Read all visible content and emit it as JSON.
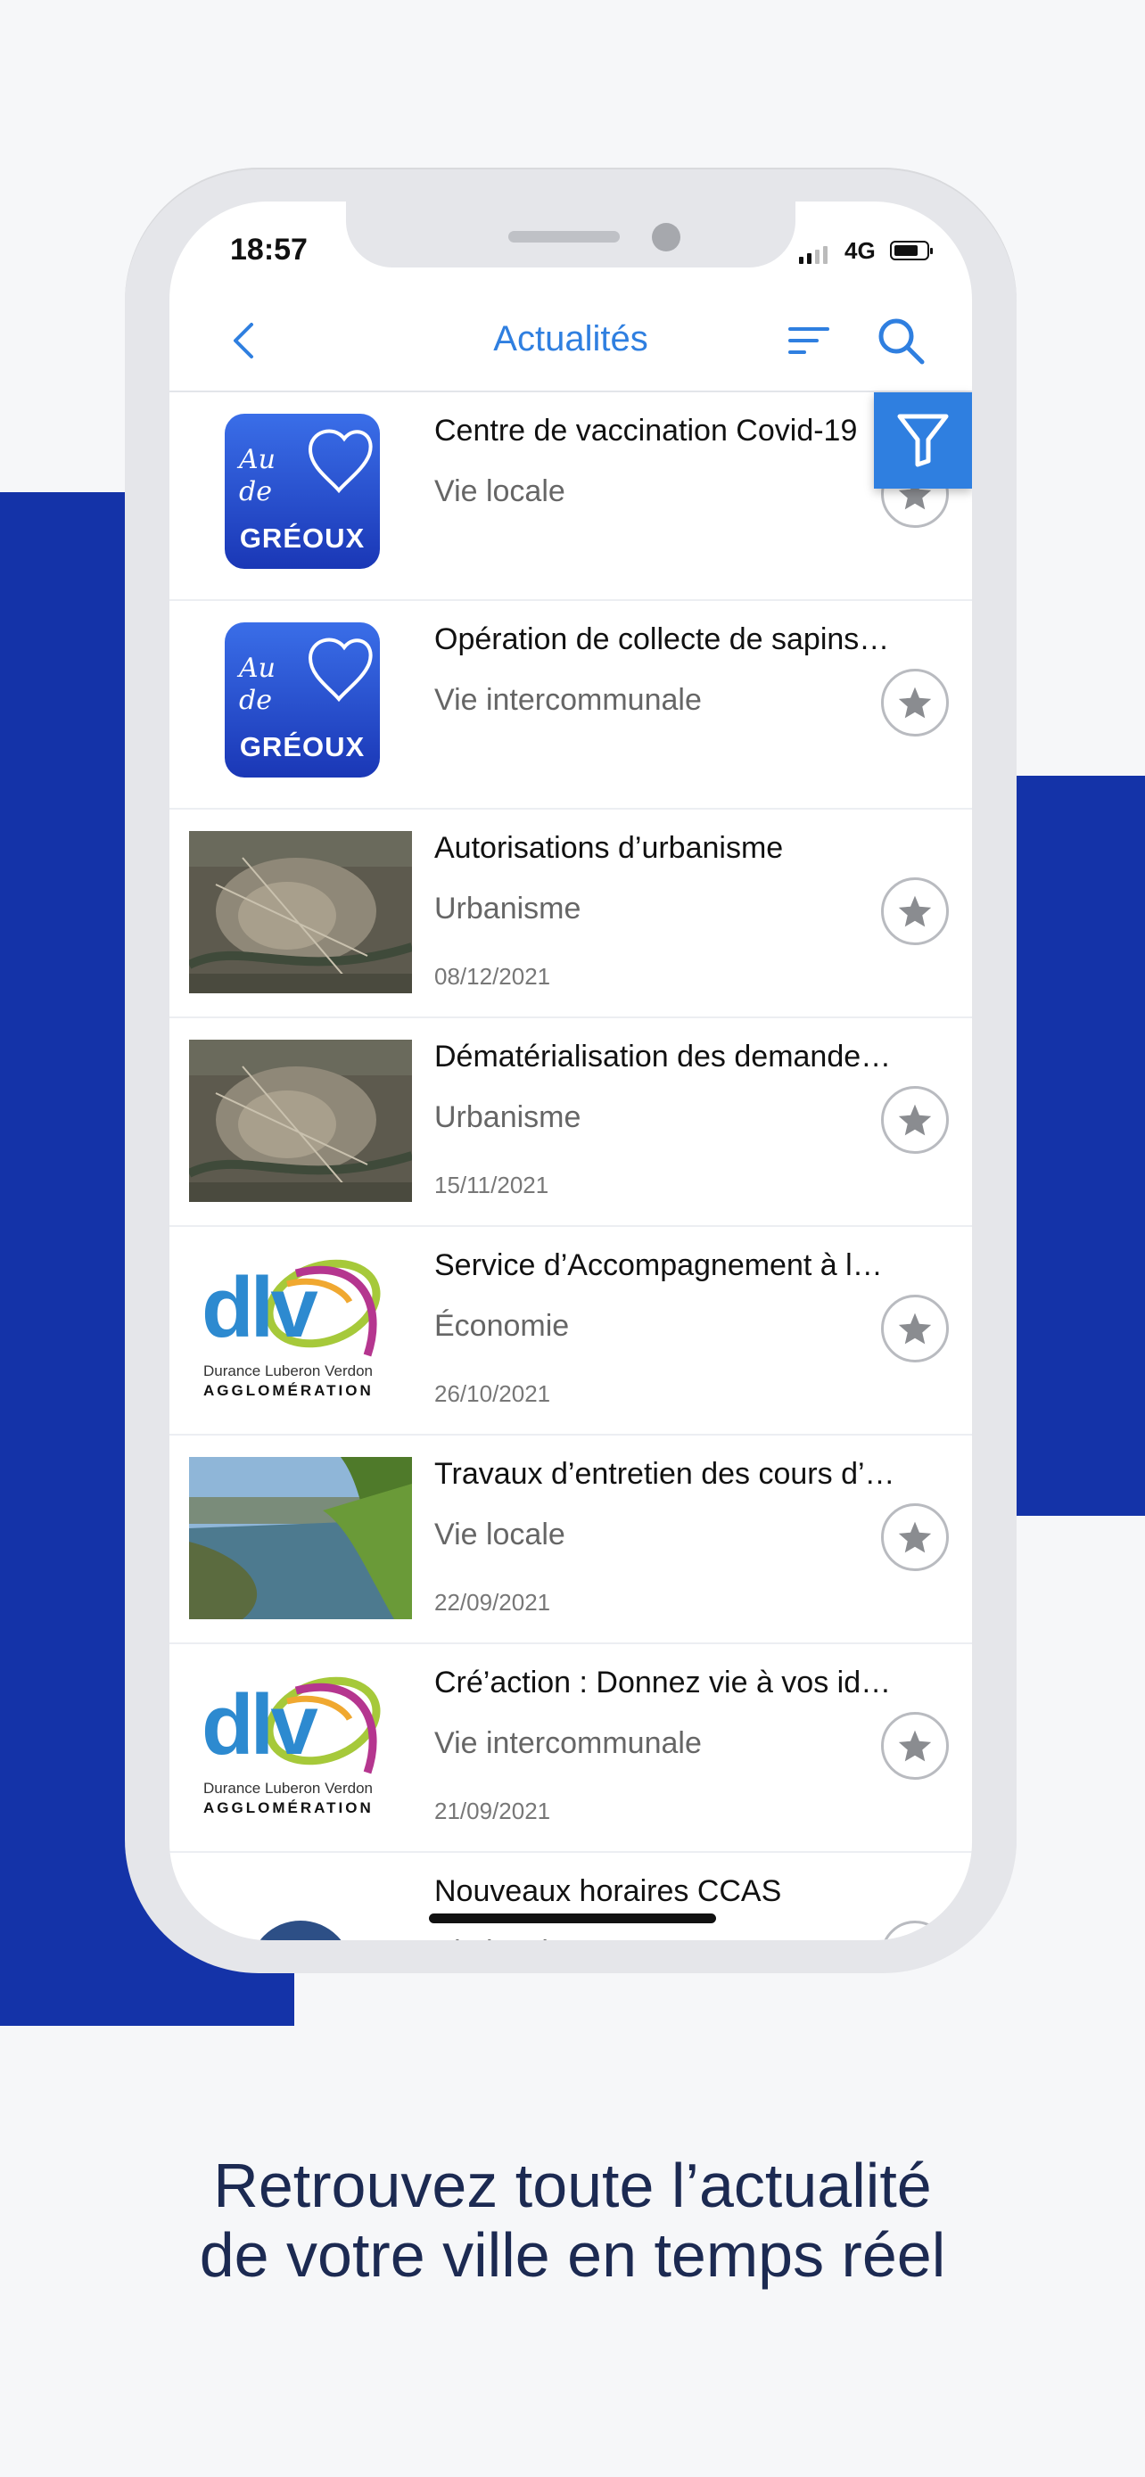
{
  "status_bar": {
    "time": "18:57",
    "network": "4G",
    "battery_level": 0.75
  },
  "header": {
    "title": "Actualités"
  },
  "list": {
    "items": [
      {
        "title": "Centre de vaccination Covid-19",
        "category": "Vie locale",
        "date": "",
        "thumb": "greoux"
      },
      {
        "title": "Opération de collecte de sapins…",
        "category": "Vie intercommunale",
        "date": "",
        "thumb": "greoux"
      },
      {
        "title": "Autorisations d’urbanisme",
        "category": "Urbanisme",
        "date": "08/12/2021",
        "thumb": "aerial"
      },
      {
        "title": "Dématérialisation des demande…",
        "category": "Urbanisme",
        "date": "15/11/2021",
        "thumb": "aerial"
      },
      {
        "title": "Service d’Accompagnement à la…",
        "category": "Économie",
        "date": "26/10/2021",
        "thumb": "dlv"
      },
      {
        "title": "Travaux d’entretien des cours d’…",
        "category": "Vie locale",
        "date": "22/09/2021",
        "thumb": "river"
      },
      {
        "title": "Cré’action : Donnez vie à vos idé…",
        "category": "Vie intercommunale",
        "date": "21/09/2021",
        "thumb": "dlv"
      },
      {
        "title": "Nouveaux horaires CCAS",
        "category": "Vie locale",
        "date": "",
        "thumb": "ccas"
      }
    ]
  },
  "logos": {
    "greoux_script": "Au de",
    "greoux_name": "GRÉOUX",
    "dlv_mark": "dlv",
    "dlv_line1": "Durance Luberon Verdon",
    "dlv_line2": "AGGLOMÉRATION"
  },
  "tagline": {
    "line1": "Retrouvez toute l’actualité",
    "line2": "de votre ville en temps réel"
  },
  "colors": {
    "brand_blue": "#1433a8",
    "accent_blue": "#2f7fe0"
  },
  "icons": {
    "back": "chevron-left-icon",
    "sort": "sort-icon",
    "search": "search-icon",
    "filter": "filter-icon",
    "favorite": "star-icon"
  }
}
